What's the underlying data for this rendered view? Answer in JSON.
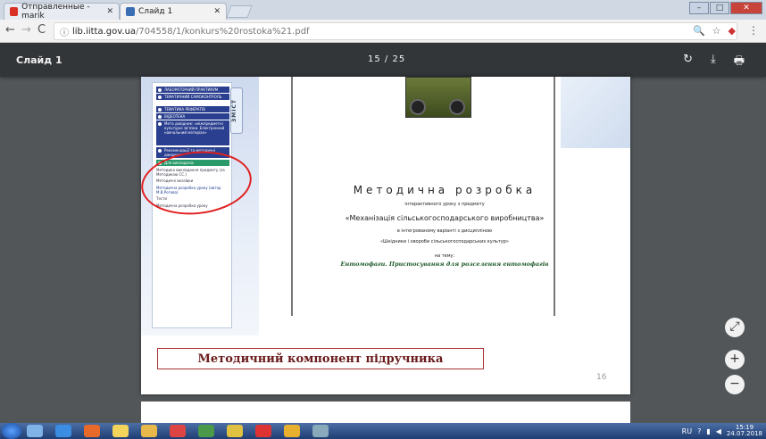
{
  "browser": {
    "tabs": [
      {
        "title": "Отправленные - marik",
        "favicon": "gmail-icon"
      },
      {
        "title": "Слайд 1",
        "favicon": "user-icon"
      }
    ],
    "address": {
      "host": "lib.iitta.gov.ua",
      "path": "/704558/1/konkurs%20rostoka%21.pdf"
    }
  },
  "pdf_viewer": {
    "title": "Слайд 1",
    "page_current": "15",
    "page_total": "25",
    "page_sep": " / "
  },
  "slide": {
    "heading": "Методична розробка",
    "line1": "інтерактивного уроку з предмету",
    "line2": "«Механізація сільськогосподарського виробництва»",
    "line3": "в інтегрованому варіанті з дисципліною",
    "line4": "«Шкідники і хвороби сільськогосподарських культур»",
    "line5": "на тему:",
    "line6": "Ентомофаги. Пристосування для розселення ентомофагів",
    "menu_label": "ЗМІСТ",
    "menu_items": [
      "ЛАБОРАТОРНИЙ ПРАКТИКУМ",
      "ТЕМАТИЧНИЙ САМОКОНТРОЛЬ",
      "ТЕМАТИКА РЕФЕРАТІВ",
      "ВІДЕОТЕКА",
      "Мета довідник: «міжпредметні культурні зв'язки. Електронний навчальний матеріал»",
      "Рекомендації та методичні джерела",
      "Для викладачів"
    ],
    "submenu_items": [
      "Методика викладання предмету (за Методикою СС.)",
      "Методичні вказівки",
      "Методична розробка уроку (автор М.В.Рогова)",
      "Тести",
      "Методична розробка уроку"
    ]
  },
  "caption": "Методичний компонент підручника",
  "page_number": "16",
  "taskbar": {
    "lang": "RU",
    "time": "15:19",
    "date": "24.07.2018"
  }
}
